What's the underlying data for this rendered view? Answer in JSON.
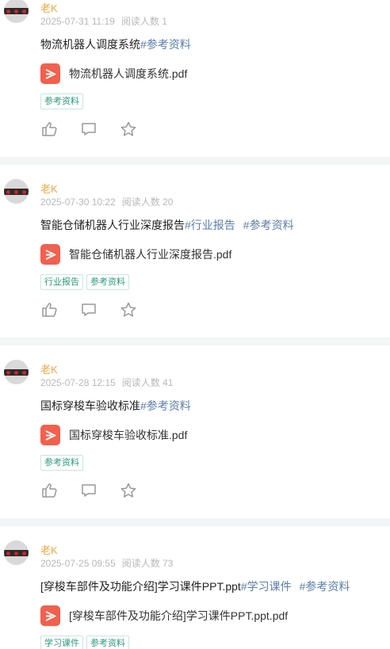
{
  "posts": [
    {
      "author": "老K",
      "date": "2025-07-31 11:19",
      "reads": "阅读人数 1",
      "title": "物流机器人调度系统",
      "tags": [
        "#参考资料"
      ],
      "file": "物流机器人调度系统.pdf",
      "chips": [
        "参考资料"
      ]
    },
    {
      "author": "老K",
      "date": "2025-07-30 10:22",
      "reads": "阅读人数 20",
      "title": "智能仓储机器人行业深度报告",
      "tags": [
        "#行业报告",
        "#参考资料"
      ],
      "file": "智能仓储机器人行业深度报告.pdf",
      "chips": [
        "行业报告",
        "参考资料"
      ]
    },
    {
      "author": "老K",
      "date": "2025-07-28 12:15",
      "reads": "阅读人数 41",
      "title": "国标穿梭车验收标准",
      "tags": [
        "#参考资料"
      ],
      "file": "国标穿梭车验收标准.pdf",
      "chips": [
        "参考资料"
      ]
    },
    {
      "author": "老K",
      "date": "2025-07-25 09:55",
      "reads": "阅读人数 73",
      "title": "[穿梭车部件及功能介绍]学习课件PPT.ppt",
      "tags": [
        "#学习课件",
        "#参考资料"
      ],
      "file": "[穿梭车部件及功能介绍]学习课件PPT.ppt.pdf",
      "chips": [
        "学习课件",
        "参考资料"
      ]
    }
  ],
  "colors": {
    "author": "#f0a640",
    "tag": "#5a7ea8",
    "chip": "#2a9a7c",
    "pdf": "#f2604e"
  },
  "icons": {
    "like": "thumbs-up-icon",
    "comment": "comment-icon",
    "favorite": "star-icon",
    "file": "pdf-file-icon"
  }
}
